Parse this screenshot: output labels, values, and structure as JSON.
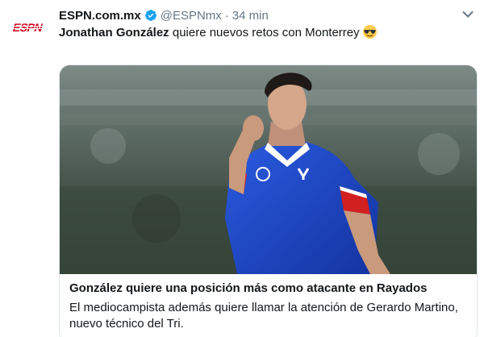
{
  "account": {
    "display_name": "ESPN.com.mx",
    "handle": "@ESPNmx",
    "separator": "·",
    "time": "34 min",
    "logo_text": "ESPN"
  },
  "tweet": {
    "mention": "Jonathan González",
    "text": " quiere nuevos retos con Monterrey"
  },
  "card": {
    "title": "González quiere una posición más como atacante en Rayados",
    "description": "El mediocampista además quiere llamar la atención de Gerardo Martino, nuevo técnico del Tri."
  },
  "icons": {
    "verified": "verified-badge-icon",
    "menu": "chevron-down-icon",
    "emoji": "sunglasses-emoji-icon"
  },
  "colors": {
    "espn_red": "#d0021b",
    "verified_blue": "#1da1f2",
    "jersey_blue": "#1c45c8",
    "muted_text": "#657786",
    "card_border": "#e1e8ed"
  }
}
